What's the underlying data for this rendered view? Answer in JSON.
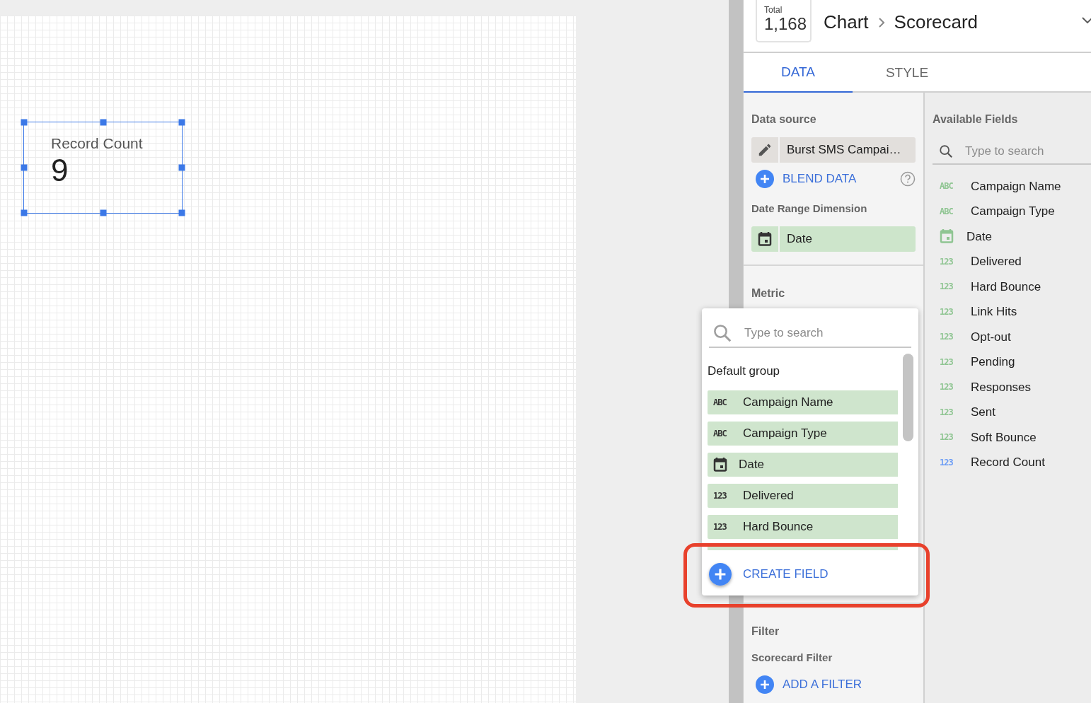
{
  "canvas": {
    "scorecard": {
      "label": "Record Count",
      "value": "9",
      "selected": true
    }
  },
  "header": {
    "total_label": "Total",
    "total_value": "1,168",
    "breadcrumb": [
      "Chart",
      "Scorecard"
    ]
  },
  "tabs": [
    {
      "label": "DATA",
      "selected": true
    },
    {
      "label": "STYLE",
      "selected": false
    }
  ],
  "setup": {
    "data_source_heading": "Data source",
    "data_source": "Burst SMS Campai…",
    "blend": "BLEND DATA",
    "date_range_heading": "Date Range Dimension",
    "date_range": "Date",
    "metric_heading": "Metric",
    "filter_heading": "Filter",
    "filter_sub": "Scorecard Filter",
    "add_filter": "ADD A FILTER"
  },
  "available": {
    "heading": "Available Fields",
    "placeholder": "Type to search",
    "fields": [
      {
        "kind": "text",
        "type_label": "ABC",
        "label": "Campaign Name",
        "color": "#8fc592"
      },
      {
        "kind": "text",
        "type_label": "ABC",
        "label": "Campaign Type",
        "color": "#8fc592"
      },
      {
        "kind": "date",
        "label": "Date",
        "color": "#8fc592"
      },
      {
        "kind": "number",
        "type_label": "123",
        "label": "Delivered",
        "color": "#8fc592"
      },
      {
        "kind": "number",
        "type_label": "123",
        "label": "Hard Bounce",
        "color": "#8fc592"
      },
      {
        "kind": "number",
        "type_label": "123",
        "label": "Link Hits",
        "color": "#8fc592"
      },
      {
        "kind": "number",
        "type_label": "123",
        "label": "Opt-out",
        "color": "#8fc592"
      },
      {
        "kind": "number",
        "type_label": "123",
        "label": "Pending",
        "color": "#8fc592"
      },
      {
        "kind": "number",
        "type_label": "123",
        "label": "Responses",
        "color": "#8fc592"
      },
      {
        "kind": "number",
        "type_label": "123",
        "label": "Sent",
        "color": "#8fc592"
      },
      {
        "kind": "number",
        "type_label": "123",
        "label": "Soft Bounce",
        "color": "#8fc592"
      },
      {
        "kind": "number",
        "type_label": "123",
        "label": "Record Count",
        "color": "#6b9cf5"
      }
    ]
  },
  "popup": {
    "placeholder": "Type to search",
    "group": "Default group",
    "fields": [
      {
        "kind": "text",
        "type_label": "ABC",
        "label": "Campaign Name"
      },
      {
        "kind": "text",
        "type_label": "ABC",
        "label": "Campaign Type"
      },
      {
        "kind": "date",
        "label": "Date"
      },
      {
        "kind": "number",
        "type_label": "123",
        "label": "Delivered"
      },
      {
        "kind": "number",
        "type_label": "123",
        "label": "Hard Bounce"
      }
    ],
    "create": "CREATE FIELD",
    "highlighted": true
  }
}
